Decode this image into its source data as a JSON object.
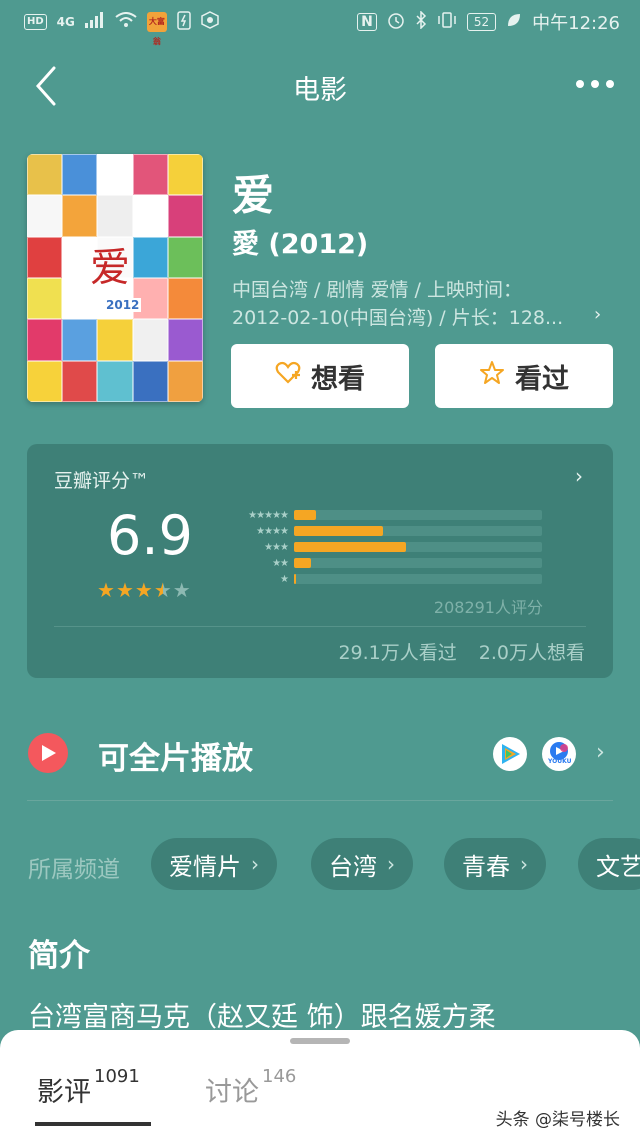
{
  "status_bar": {
    "left_chip": "HD",
    "network": "4G",
    "app_badge": "大富翁",
    "battery": "52",
    "time": "中午12:26"
  },
  "nav": {
    "title": "电影"
  },
  "movie": {
    "title": "爱",
    "original_title": "愛 (2012)",
    "meta_line1": "中国台湾 / 剧情 爱情 / 上映时间：",
    "meta_line2": "2012-02-10(中国台湾) / 片长：128...",
    "poster_glyph": "爱",
    "poster_badge": "2012"
  },
  "buttons": {
    "want": "想看",
    "seen": "看过"
  },
  "rating": {
    "label": "豆瓣评分™",
    "score": "6.9",
    "stars": 3.5,
    "distribution_percent": [
      9,
      36,
      45,
      7,
      1
    ],
    "star_labels": [
      "★★★★★",
      "★★★★",
      "★★★",
      "★★",
      "★"
    ],
    "count": "208291人评分",
    "watched": "29.1万人看过",
    "wanted": "2.0万人想看"
  },
  "play": {
    "label": "可全片播放",
    "platform2": "YOUKU"
  },
  "channels": {
    "label": "所属频道",
    "items": [
      "爱情片",
      "台湾",
      "青春",
      "文艺"
    ]
  },
  "intro": {
    "title": "简介",
    "text": "台湾富商马克（赵又廷 饰）跟名媛方柔"
  },
  "bottom_tabs": {
    "reviews_label": "影评",
    "reviews_count": "1091",
    "discuss_label": "讨论",
    "discuss_count": "146"
  },
  "watermark": "头条 @柒号楼长",
  "colors": {
    "background": "#4f9a90",
    "card": "#3e8077",
    "accent": "#f5a623"
  }
}
